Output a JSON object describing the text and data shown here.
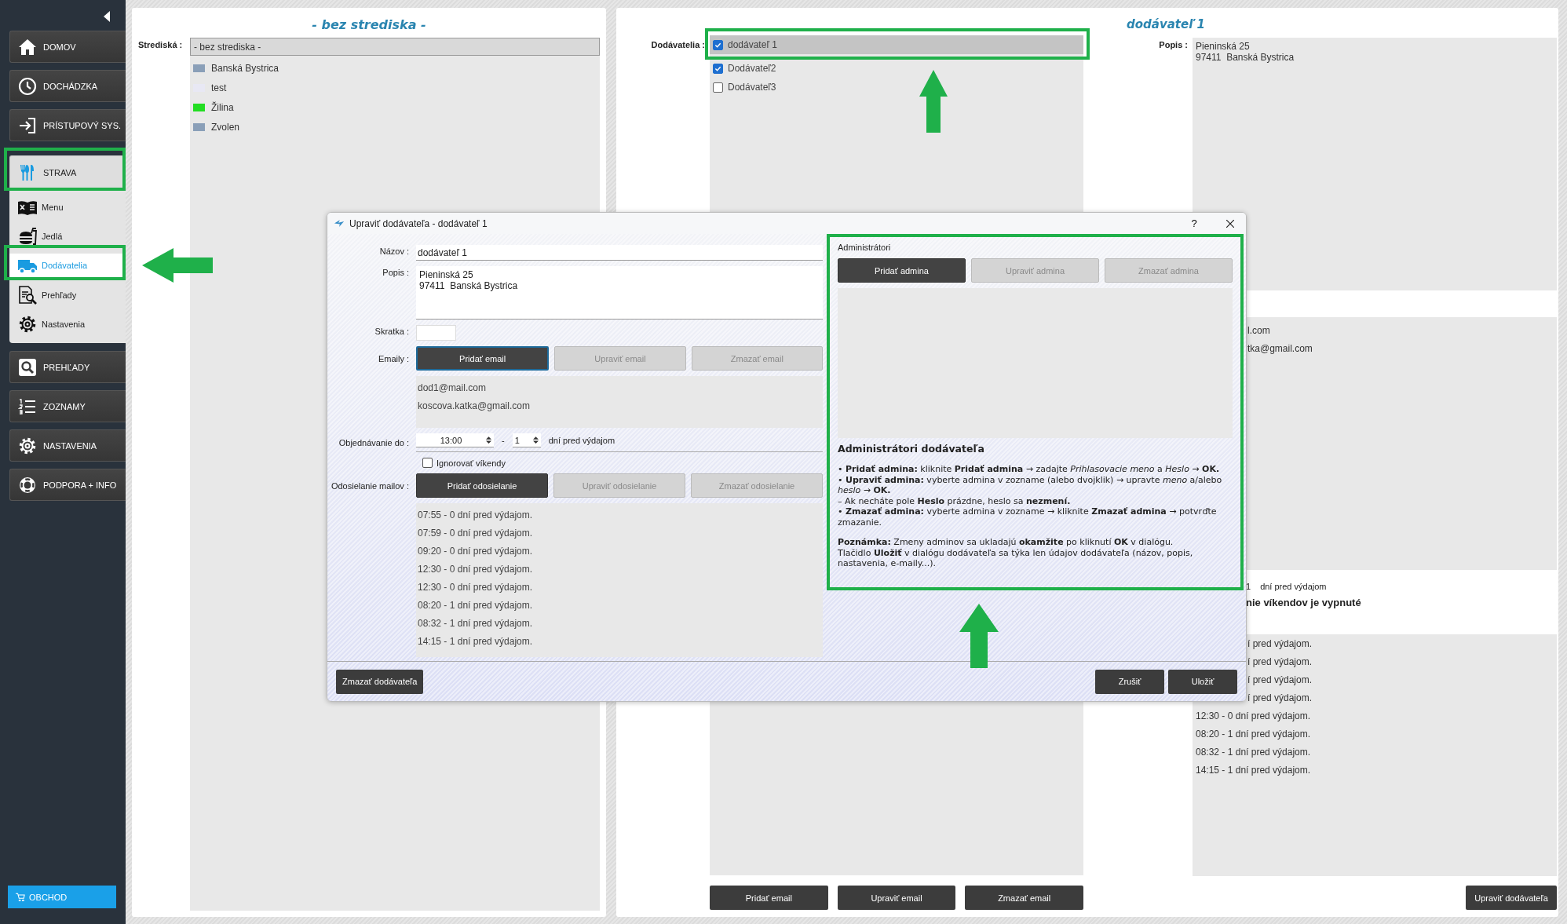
{
  "nav": [
    {
      "label": "DOMOV",
      "expanded": false
    },
    {
      "label": "DOCHÁDZKA",
      "expanded": false
    },
    {
      "label": "PRÍSTUPOVÝ SYS.",
      "expanded": false
    },
    {
      "label": "STRAVA",
      "expanded": true,
      "children": [
        {
          "label": "Menu",
          "selected": false
        },
        {
          "label": "Jedlá",
          "selected": false
        },
        {
          "label": "Dodávatelia",
          "selected": true
        },
        {
          "label": "Prehľady",
          "selected": false
        },
        {
          "label": "Nastavenia",
          "selected": false
        }
      ]
    },
    {
      "label": "PREHĽADY",
      "expanded": false
    },
    {
      "label": "ZOZNAMY",
      "expanded": false
    },
    {
      "label": "NASTAVENIA",
      "expanded": false
    },
    {
      "label": "PODPORA + INFO",
      "expanded": false
    }
  ],
  "shop_button": "OBCHOD",
  "branches": {
    "title": "- bez strediska -",
    "label": "Strediská :",
    "items": [
      {
        "name": "- bez strediska -",
        "selected": true
      },
      {
        "name": "Banská Bystrica",
        "color": "#8a9fb8",
        "selected": false
      },
      {
        "name": "test",
        "color": "#e8e8f4",
        "selected": false
      },
      {
        "name": "Žilina",
        "color": "#22dd22",
        "selected": false
      },
      {
        "name": "Zvolen",
        "color": "#8a9fb8",
        "selected": false
      }
    ]
  },
  "supplier": {
    "title": "dodávateľ 1",
    "list_label": "Dodávatelia :",
    "suppliers": [
      {
        "name": "dodávateľ 1",
        "checked": true,
        "selected": true
      },
      {
        "name": "Dodávateľ2",
        "checked": true,
        "selected": false
      },
      {
        "name": "Dodávateľ3",
        "checked": false,
        "selected": false
      }
    ],
    "description_label": "Popis :",
    "description": "Pieninská 25\n97411  Banská Bystrica",
    "emails": [
      "l.com",
      "tka@gmail.com"
    ],
    "order_days": "1",
    "order_suffix": "dní pred výdajom",
    "weekend_note": "nie víkendov je vypnuté",
    "send_times_partial": [
      "í pred výdajom.",
      "í pred výdajom.",
      "í pred výdajom.",
      "í pred výdajom."
    ],
    "send_times": [
      "12:30 - 0 dní pred výdajom.",
      "08:20 - 1 dní pred výdajom.",
      "08:32 - 1 dní pred výdajom.",
      "14:15 - 1 dní pred výdajom."
    ],
    "email_buttons": [
      "Pridať email",
      "Upraviť email",
      "Zmazať email"
    ],
    "edit_button": "Upraviť dodávateľa"
  },
  "dialog": {
    "title": "Upraviť dodávateľa - dodávateľ 1",
    "help_glyph": "?",
    "name_label": "Názov :",
    "name": "dodávateľ 1",
    "description_label": "Popis :",
    "description": "Pieninská 25\n97411  Banská Bystrica",
    "short_label": "Skratka :",
    "emails_label": "Emaily :",
    "email_buttons": [
      {
        "label": "Pridať email",
        "disabled": false,
        "focused": true
      },
      {
        "label": "Upraviť email",
        "disabled": true,
        "focused": false
      },
      {
        "label": "Zmazať email",
        "disabled": true,
        "focused": false
      }
    ],
    "emails": [
      "dod1@mail.com",
      "koscova.katka@gmail.com"
    ],
    "order_label": "Objednávanie do :",
    "order_time": "13:00",
    "order_dash": "-",
    "order_days": "1",
    "order_suffix": "dní pred výdajom",
    "ignore_weekends": {
      "label": "Ignorovať víkendy",
      "checked": false
    },
    "sending_label": "Odosielanie mailov :",
    "sending_buttons": [
      {
        "label": "Pridať odosielanie",
        "disabled": false,
        "focused": false
      },
      {
        "label": "Upraviť odosielanie",
        "disabled": true,
        "focused": false
      },
      {
        "label": "Zmazať odosielanie",
        "disabled": true,
        "focused": false
      }
    ],
    "send_times": [
      "07:55 - 0 dní pred výdajom.",
      "07:59 - 0 dní pred výdajom.",
      "09:20 - 0 dní pred výdajom.",
      "12:30 - 0 dní pred výdajom.",
      "12:30 - 0 dní pred výdajom.",
      "08:20 - 1 dní pred výdajom.",
      "08:32 - 1 dní pred výdajom.",
      "14:15 - 1 dní pred výdajom."
    ],
    "admins": {
      "label": "Administrátori",
      "buttons": [
        {
          "label": "Pridať admina",
          "disabled": false,
          "focused": false
        },
        {
          "label": "Upraviť admina",
          "disabled": true,
          "focused": false
        },
        {
          "label": "Zmazať admina",
          "disabled": true,
          "focused": false
        }
      ],
      "help_title": "Administrátori dodávateľa",
      "help_lines": [
        "• **Pridať admina:** kliknite **Pridať admina** → zadajte *Prihlasovacie meno* a *Heslo* → **OK.**",
        "• **Upraviť admina:** vyberte admina v zozname (alebo dvojklik) → upravte *meno* a/alebo *heslo* → **OK.**",
        "– Ak necháte pole **Heslo** prázdne, heslo sa **nezmení.**",
        "• **Zmazať admina:** vyberte admina v zozname → kliknite **Zmazať admina** → potvrďte zmazanie."
      ],
      "note_lines": [
        "**Poznámka:** Zmeny adminov sa ukladajú **okamžite** po kliknutí **OK** v dialógu.",
        "Tlačidlo **Uložiť** v dialógu dodávateľa sa týka len údajov dodávateľa (názov, popis, nastavenia, e-maily...)."
      ]
    },
    "delete_button": "Zmazať dodávateľa",
    "cancel_button": "Zrušiť",
    "save_button": "Uložiť"
  }
}
